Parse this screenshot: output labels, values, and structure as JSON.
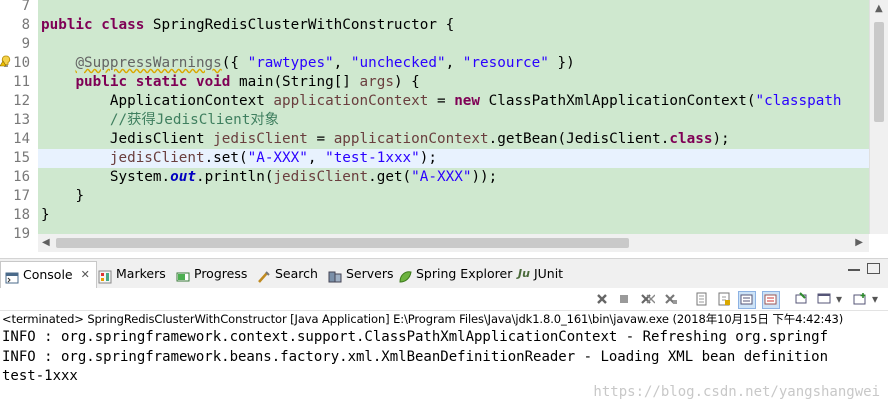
{
  "editor": {
    "line_numbers": [
      "7",
      "8",
      "9",
      "10",
      "11",
      "12",
      "13",
      "14",
      "15",
      "16",
      "17",
      "18",
      "19"
    ],
    "lines": {
      "l8": {
        "kw1": "public",
        "kw2": "class",
        "name": "SpringRedisClusterWithConstructor",
        "brace": "{"
      },
      "l10": {
        "ann": "@SuppressWarnings",
        "open": "({ ",
        "s1": "\"rawtypes\"",
        "c1": ", ",
        "s2": "\"unchecked\"",
        "c2": ", ",
        "s3": "\"resource\"",
        "close": " })"
      },
      "l11": {
        "kw1": "public",
        "kw2": "static",
        "kw3": "void",
        "rest": "main(String[] ",
        "arg": "args",
        "end": ") {"
      },
      "l12": {
        "type": "ApplicationContext",
        "var": "applicationContext",
        "eq": " = ",
        "kw": "new",
        "rest": "ClassPathXmlApplicationContext(",
        "str": "\"classpath"
      },
      "l13": {
        "comment": "//获得JedisClient对象"
      },
      "l14": {
        "type": "JedisClient",
        "var": "jedisClient",
        "eq": " = ",
        "ref": "applicationContext",
        "rest": ".getBean(JedisClient.",
        "kw": "class",
        "end": ");"
      },
      "l15": {
        "var": "jedisClient",
        "rest": ".set(",
        "s1": "\"A-XXX\"",
        "c": ", ",
        "s2": "\"test-1xxx\"",
        "end": ");"
      },
      "l16": {
        "pre": "System.",
        "field": "out",
        "mid": ".println(",
        "var": "jedisClient",
        "rest": ".get(",
        "str": "\"A-XXX\"",
        "end": "));"
      },
      "l17": {
        "brace": "}"
      },
      "l18": {
        "brace": "}"
      }
    }
  },
  "views": {
    "tabs": [
      {
        "label": "Console",
        "icon": "console-icon"
      },
      {
        "label": "Markers",
        "icon": "markers-icon"
      },
      {
        "label": "Progress",
        "icon": "progress-icon"
      },
      {
        "label": "Search",
        "icon": "search-icon"
      },
      {
        "label": "Servers",
        "icon": "servers-icon"
      },
      {
        "label": "Spring Explorer",
        "icon": "spring-leaf-icon"
      },
      {
        "label": "JUnit",
        "icon": "junit-icon",
        "prefix": "Ju"
      }
    ]
  },
  "console": {
    "terminated_line": "<terminated> SpringRedisClusterWithConstructor [Java Application] E:\\Program Files\\Java\\jdk1.8.0_161\\bin\\javaw.exe (2018年10月15日 下午4:42:43)",
    "output": [
      "INFO : org.springframework.context.support.ClassPathXmlApplicationContext - Refreshing org.springf",
      "INFO : org.springframework.beans.factory.xml.XmlBeanDefinitionReader - Loading XML bean definition",
      "test-1xxx"
    ],
    "watermark": "https://blog.csdn.net/yangshangwei"
  },
  "colors": {
    "editor_bg": "#cfe8cf",
    "current_line": "#e8f2fe",
    "keyword": "#7f0055",
    "string": "#2a00ff",
    "comment": "#3f7f5f",
    "field": "#0000c0",
    "local_var": "#6a3e3e"
  }
}
